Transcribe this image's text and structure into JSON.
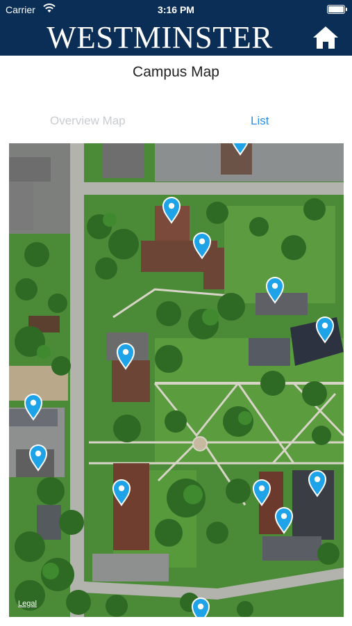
{
  "status_bar": {
    "carrier": "Carrier",
    "time": "3:16 PM",
    "icons": [
      "wifi-icon",
      "battery-icon"
    ]
  },
  "brand": {
    "title": "WESTMINSTER",
    "home_icon": "home-icon",
    "background": "#0b2e57"
  },
  "page": {
    "title": "Campus Map"
  },
  "tabs": [
    {
      "label": "Overview Map",
      "selected": false
    },
    {
      "label": "List",
      "selected": true
    }
  ],
  "map": {
    "legal_label": "Legal",
    "pin_color": "#1fa3e8",
    "pin_count": 15
  }
}
